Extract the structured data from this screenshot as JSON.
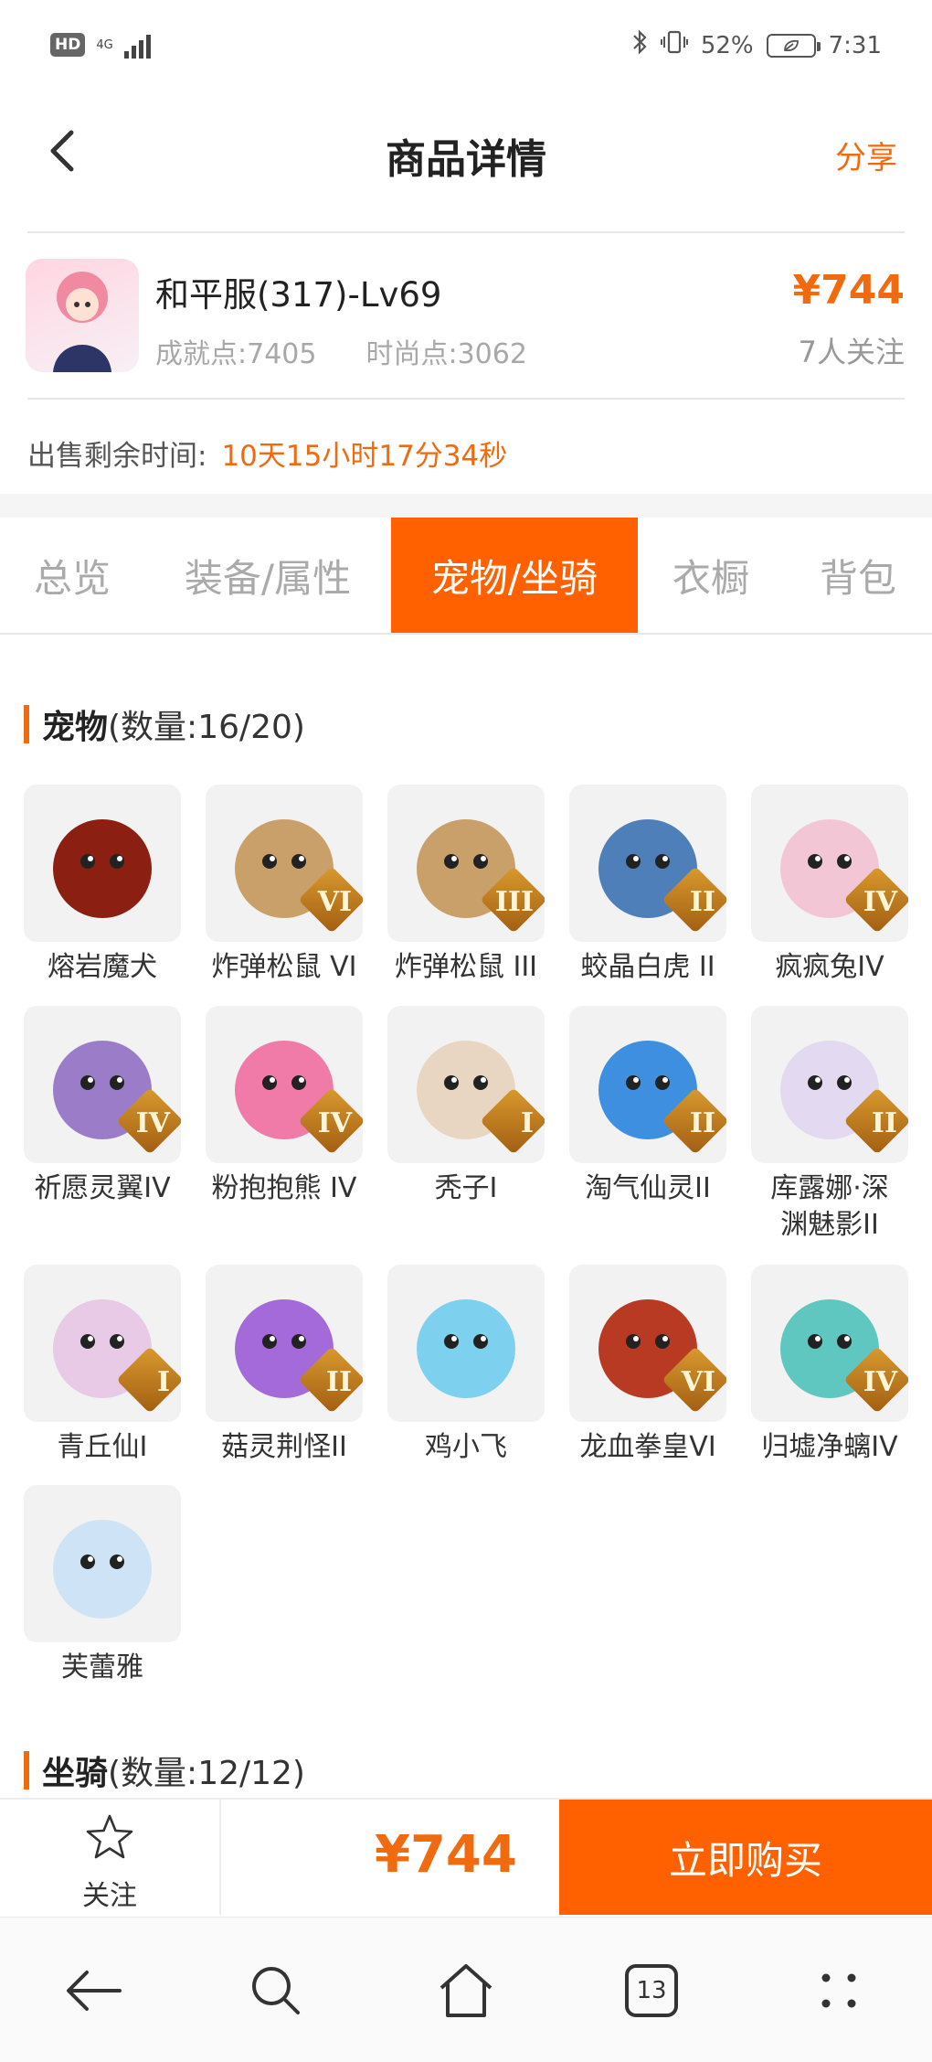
{
  "status": {
    "hd": "HD",
    "network": "4G",
    "battery_percent": "52%",
    "time": "7:31"
  },
  "header": {
    "title": "商品详情",
    "share": "分享"
  },
  "product": {
    "name": "和平服(317)-Lv69",
    "achievement": "成就点:7405",
    "fashion": "时尚点:3062",
    "price": "¥744",
    "followers": "7人关注"
  },
  "remaining": {
    "label": "出售剩余时间:",
    "time": "10天15小时17分34秒"
  },
  "tabs": [
    {
      "label": "总览",
      "active": false
    },
    {
      "label": "装备/属性",
      "active": false
    },
    {
      "label": "宠物/坐骑",
      "active": true
    },
    {
      "label": "衣橱",
      "active": false
    },
    {
      "label": "背包",
      "active": false
    }
  ],
  "pets_section": {
    "title": "宠物",
    "count": "(数量:16/20)"
  },
  "pets": [
    {
      "name": "熔岩魔犬",
      "badge": "",
      "color": "#8a1f12"
    },
    {
      "name": "炸弹松鼠 VI",
      "badge": "VI",
      "color": "#c9a06a"
    },
    {
      "name": "炸弹松鼠 III",
      "badge": "III",
      "color": "#c9a06a"
    },
    {
      "name": "蛟晶白虎 II",
      "badge": "II",
      "color": "#4f7fb8"
    },
    {
      "name": "疯疯兔IV",
      "badge": "IV",
      "color": "#f3c6d6"
    },
    {
      "name": "祈愿灵翼IV",
      "badge": "IV",
      "color": "#9b7cc9"
    },
    {
      "name": "粉抱抱熊 IV",
      "badge": "IV",
      "color": "#f07aa8"
    },
    {
      "name": "秃子I",
      "badge": "I",
      "color": "#e9d6c2"
    },
    {
      "name": "淘气仙灵II",
      "badge": "II",
      "color": "#3f8fe0"
    },
    {
      "name": "库露娜·深渊魅影II",
      "badge": "II",
      "color": "#e3d9f0"
    },
    {
      "name": "青丘仙I",
      "badge": "I",
      "color": "#e8c9e6"
    },
    {
      "name": "菇灵荆怪II",
      "badge": "II",
      "color": "#a56ad9"
    },
    {
      "name": "鸡小飞",
      "badge": "",
      "color": "#7ed0ef"
    },
    {
      "name": "龙血拳皇VI",
      "badge": "VI",
      "color": "#b83a22"
    },
    {
      "name": "归墟净螭IV",
      "badge": "IV",
      "color": "#5fc6c0"
    },
    {
      "name": "芙蕾雅",
      "badge": "",
      "color": "#cfe3f7"
    }
  ],
  "mounts_section": {
    "title": "坐骑",
    "count": "(数量:12/12)"
  },
  "bottom": {
    "follow": "关注",
    "price": "¥744",
    "buy": "立即购买"
  },
  "nav": {
    "tabs_count": "13"
  },
  "colors": {
    "accent": "#ff6000",
    "accent_text": "#f06a0f"
  }
}
